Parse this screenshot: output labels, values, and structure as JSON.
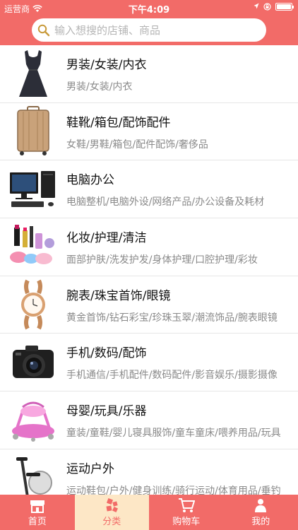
{
  "status_bar": {
    "carrier": "运营商",
    "time": "下午4:09"
  },
  "search": {
    "placeholder": "输入想搜的店铺、商品"
  },
  "categories": [
    {
      "title": "男装/女装/内衣",
      "subtitle": "男装/女装/内衣",
      "icon": "dress-icon"
    },
    {
      "title": "鞋靴/箱包/配饰配件",
      "subtitle": "女鞋/男鞋/箱包/配件配饰/奢侈品",
      "icon": "suitcase-icon"
    },
    {
      "title": "电脑办公",
      "subtitle": "电脑整机/电脑外设/网络产品/办公设备及耗材",
      "icon": "computer-icon"
    },
    {
      "title": "化妆/护理/清洁",
      "subtitle": "面部护肤/洗发护发/身体护理/口腔护理/彩妆",
      "icon": "cosmetics-icon"
    },
    {
      "title": "腕表/珠宝首饰/眼镜",
      "subtitle": "黄金首饰/钻石彩宝/珍珠玉翠/潮流饰品/腕表眼镜",
      "icon": "watch-icon"
    },
    {
      "title": "手机/数码/配饰",
      "subtitle": "手机通信/手机配件/数码配件/影音娱乐/摄影摄像",
      "icon": "camera-icon"
    },
    {
      "title": "母婴/玩具/乐器",
      "subtitle": "童装/童鞋/婴儿寝具服饰/童车童床/喂养用品/玩具",
      "icon": "baby-walker-icon"
    },
    {
      "title": "运动户外",
      "subtitle": "运动鞋包/户外/健身训练/骑行运动/体育用品/垂钓",
      "icon": "exercise-bike-icon"
    }
  ],
  "tabbar": [
    {
      "label": "首页",
      "icon": "home-icon",
      "active": false
    },
    {
      "label": "分类",
      "icon": "category-icon",
      "active": true
    },
    {
      "label": "购物车",
      "icon": "cart-icon",
      "active": false
    },
    {
      "label": "我的",
      "icon": "profile-icon",
      "active": false
    }
  ],
  "colors": {
    "brand": "#f26b68",
    "active_tab_bg": "#fde7c6"
  }
}
